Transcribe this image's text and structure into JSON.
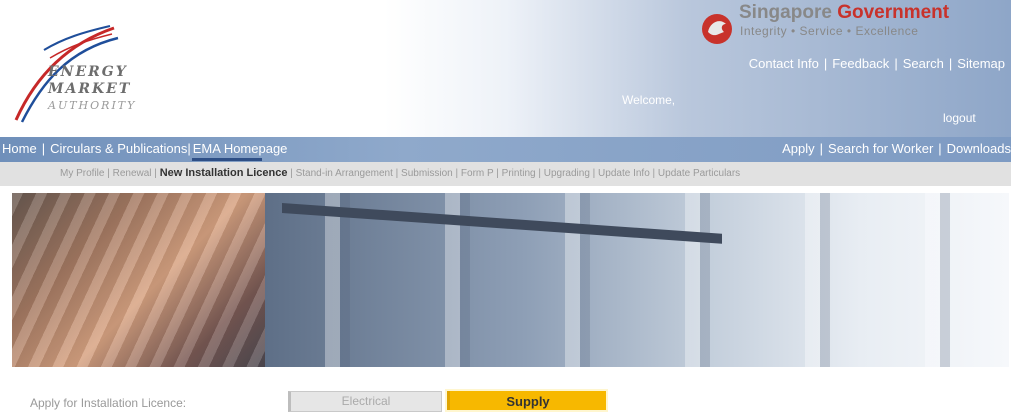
{
  "header": {
    "ema_logo_lines": [
      "ENERGY",
      "MARKET",
      "AUTHORITY"
    ],
    "gov_title_part1": "Singapore",
    "gov_title_part2": "Government",
    "gov_tagline": "Integrity • Service • Excellence",
    "top_links": [
      "Contact Info",
      "Feedback",
      "Search",
      "Sitemap"
    ],
    "welcome": "Welcome,",
    "logout": "logout"
  },
  "main_nav": {
    "left": [
      "Home",
      "Circulars & Publications",
      "EMA Homepage"
    ],
    "right": [
      "Apply",
      "Search for Worker",
      "Downloads"
    ]
  },
  "sub_nav": {
    "items": [
      "My Profile",
      "Renewal",
      "New Installation Licence",
      "Stand-in Arrangement",
      "Submission",
      "Form P",
      "Printing",
      "Upgrading",
      "Update Info",
      "Update Particulars"
    ],
    "active": "New Installation Licence"
  },
  "apply": {
    "label": "Apply for Installation Licence:",
    "electrical": "Electrical",
    "supply": "Supply"
  },
  "colors": {
    "accent": "#f7b800",
    "nav_blue": "#7e9bc3",
    "gov_red": "#c8322b"
  }
}
